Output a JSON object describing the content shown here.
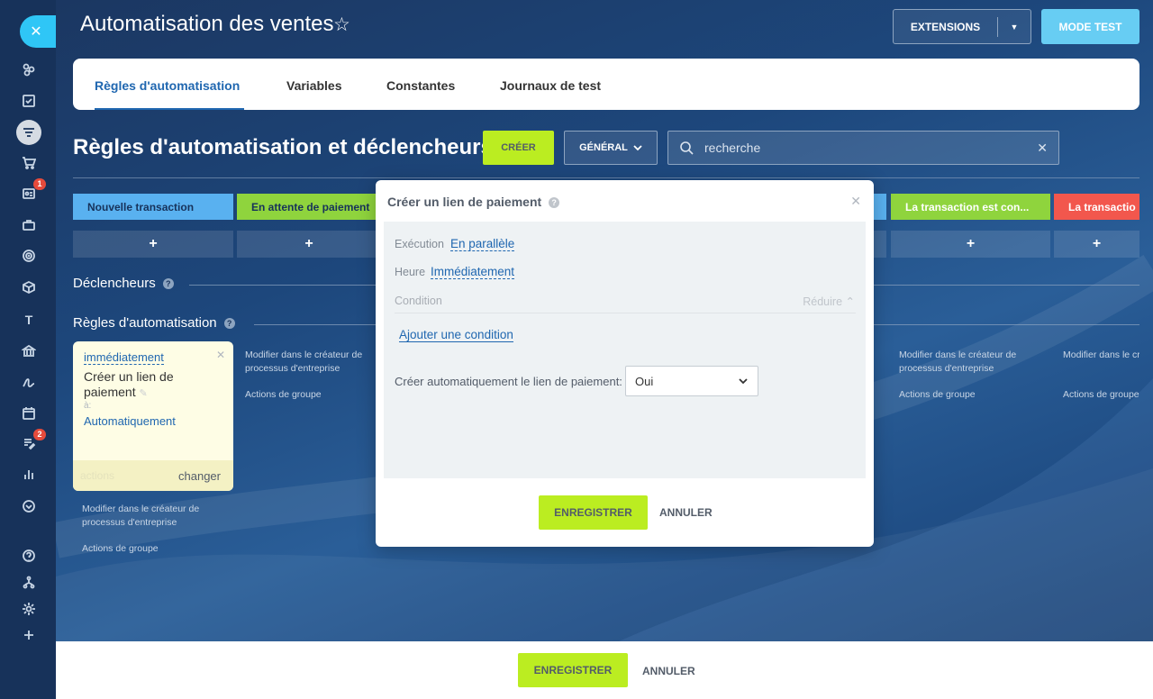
{
  "header": {
    "title": "Automatisation des ventes",
    "extensions_label": "EXTENSIONS",
    "mode_test_label": "MODE TEST"
  },
  "sidebar": {
    "badges": {
      "contacts": "1",
      "tasks": "2"
    },
    "letter_item": "T"
  },
  "tabs": [
    {
      "label": "Règles d'automatisation",
      "active": true
    },
    {
      "label": "Variables"
    },
    {
      "label": "Constantes"
    },
    {
      "label": "Journaux de test"
    }
  ],
  "section": {
    "title": "Règles d'automatisation et déclencheurs",
    "create_label": "CRÉER",
    "general_label": "GÉNÉRAL",
    "search_placeholder": "recherche"
  },
  "stages": [
    {
      "label": "Nouvelle transaction",
      "color": "#59b1f0"
    },
    {
      "label": "En attente de paiement",
      "color": "#8fd43d"
    },
    {
      "label": "La transaction est con...",
      "color": "#8fd43d"
    },
    {
      "label": "La transactio",
      "color": "#f2574d"
    }
  ],
  "triggers_label": "Déclencheurs",
  "rules_label": "Règles d'automatisation",
  "rule_card": {
    "when": "immédiatement",
    "name": "Créer un lien de paiement",
    "to_label": "à:",
    "to_value": "Automatiquement",
    "actions_label": "actions",
    "change_label": "changer"
  },
  "column_links": {
    "edit_in_designer": "Modifier dans le créateur de processus d'entreprise",
    "group_actions": "Actions de groupe"
  },
  "modal": {
    "title": "Créer un lien de paiement",
    "execution_label": "Exécution",
    "execution_value": "En parallèle",
    "time_label": "Heure",
    "time_value": "Immédiatement",
    "condition_label": "Condition",
    "reduce_label": "Réduire",
    "add_condition_label": "Ajouter une condition",
    "auto_link_label": "Créer automatiquement le lien de paiement:",
    "auto_link_value": "Oui",
    "save_label": "ENREGISTRER",
    "cancel_label": "ANNULER"
  },
  "footer": {
    "save_label": "ENREGISTRER",
    "cancel_label": "ANNULER"
  },
  "colors": {
    "accent_blue": "#2067b0",
    "primary_green": "#bbed21",
    "sidebar_close": "#2fc6f6",
    "mode_test": "#67cdf3",
    "rule_card_bg": "#fefde5"
  }
}
